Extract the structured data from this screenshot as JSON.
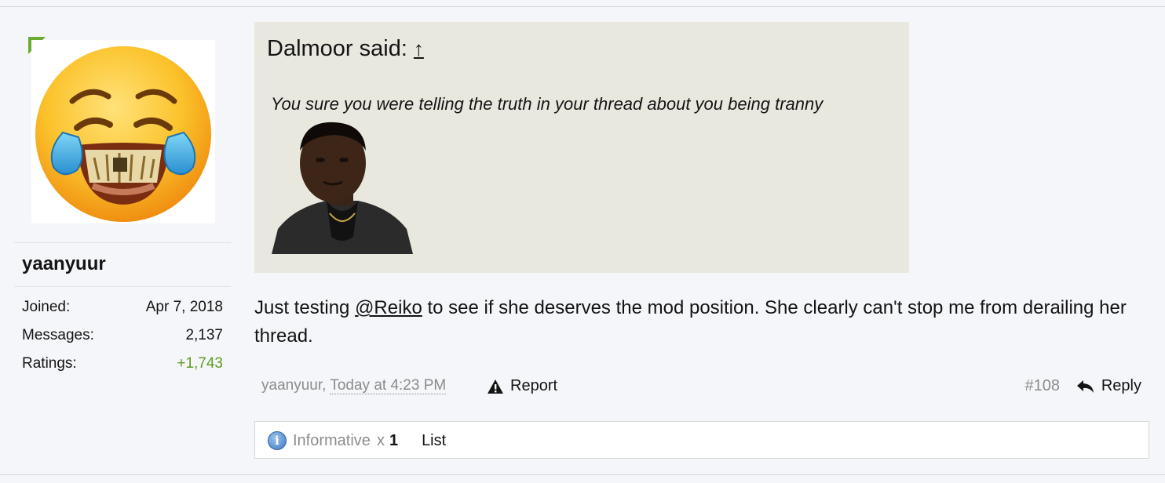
{
  "user": {
    "username": "yaanyuur",
    "avatar_icon": "laughing-crying-emoji-icon",
    "online_badge_color": "#6aab32",
    "stats": [
      {
        "label": "Joined:",
        "value": "Apr 7, 2018"
      },
      {
        "label": "Messages:",
        "value": "2,137"
      },
      {
        "label": "Ratings:",
        "value": "+1,743"
      }
    ]
  },
  "quote": {
    "author": "Dalmoor said:",
    "jump_icon": "↑",
    "text": "You sure you were telling the truth in your thread about you being tranny"
  },
  "message": {
    "before": "Just testing ",
    "mention": "@Reiko",
    "after": " to see if she deserves the mod position. She clearly can't stop me from derailing her thread."
  },
  "meta": {
    "author": "yaanyuur",
    "separator": ", ",
    "time": "Today at 4:23 PM",
    "report_label": "Report",
    "post_number": "#108",
    "reply_label": "Reply"
  },
  "ratings": {
    "label": "Informative",
    "multiplier": "x",
    "count": "1",
    "list_label": "List",
    "icon": "info-icon"
  },
  "colors": {
    "accent_positive": "#5c9e1f",
    "quote_background": "#e9e8df"
  }
}
